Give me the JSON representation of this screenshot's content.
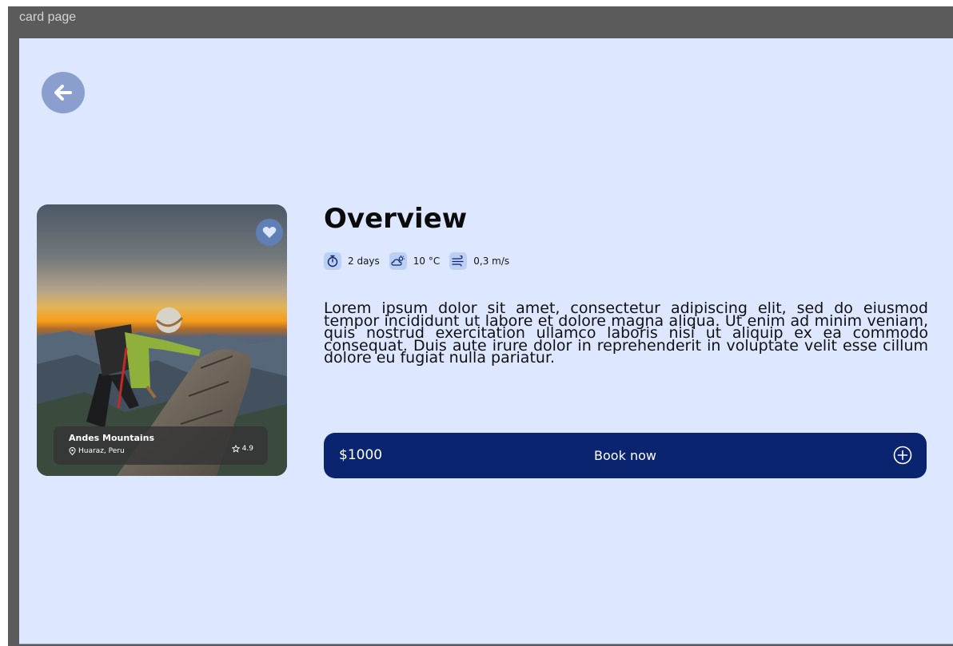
{
  "window": {
    "title": "card page"
  },
  "icons": {
    "back": "arrow-left-icon",
    "favorite": "heart-icon",
    "location": "map-pin-icon",
    "rating": "star-icon",
    "duration": "stopwatch-icon",
    "weather": "cloud-sun-icon",
    "wind": "wind-icon",
    "add": "plus-circle-icon"
  },
  "card": {
    "name": "Andes Mountains",
    "location": "Huaraz, Peru",
    "rating": "4.9"
  },
  "overview": {
    "title": "Overview",
    "stats": {
      "duration": "2 days",
      "temperature": "10 °C",
      "wind": "0,3 m/s"
    },
    "description": "Lorem ipsum dolor sit amet, consectetur adipiscing elit, sed do eiusmod tempor incididunt ut labore et dolore magna aliqua. Ut enim ad minim veniam, quis nostrud exercitation ullamco laboris nisi ut aliquip ex ea commodo consequat. Duis aute irure dolor in reprehenderit in voluptate velit esse cillum dolore eu fugiat nulla pariatur."
  },
  "booking": {
    "price": "$1000",
    "label": "Book now"
  },
  "colors": {
    "background": "#dde7ff",
    "primary": "#0b2470",
    "back_button": "#8a9fce",
    "stat_icon_bg": "#bccff5",
    "frame": "#5b5b5b"
  }
}
